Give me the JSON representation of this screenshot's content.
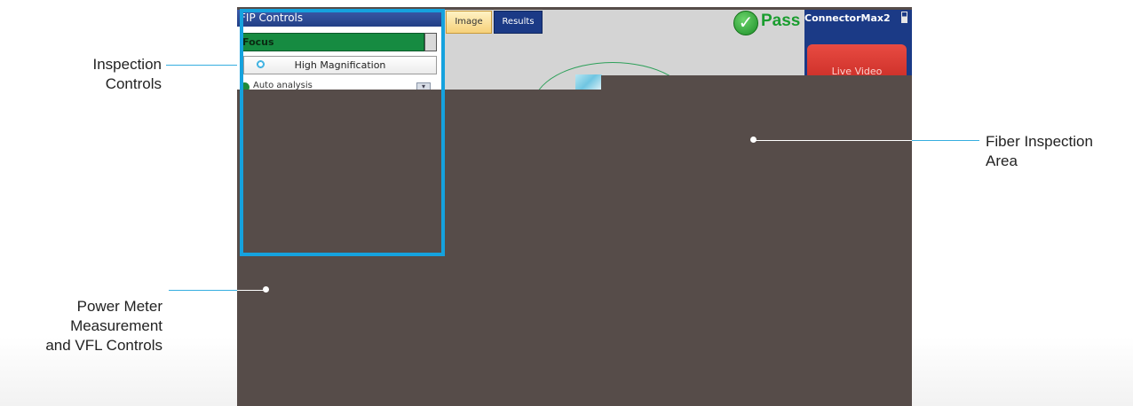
{
  "callouts": {
    "inspection_line1": "Inspection",
    "inspection_line2": "Controls",
    "power_line1": "Power Meter",
    "power_line2": "Measurement",
    "power_line3": "and VFL Controls",
    "fiber_line1": "Fiber Inspection",
    "fiber_line2": "Area"
  },
  "fip_panel": {
    "title": "FIP Controls",
    "focus_label": "Focus",
    "high_magnification_label": "High Magnification",
    "auto_row_text": "Auto analysis"
  },
  "image_area": {
    "tabs": [
      {
        "label": "Image",
        "active": true
      },
      {
        "label": "Results",
        "active": false
      }
    ],
    "status": "Pass",
    "status_color": "#1a9d2f"
  },
  "sidebar": {
    "connector_name": "ConnectorMax2",
    "live_video_label": "Live Video"
  },
  "colors": {
    "highlight": "#15a2de",
    "screen_dark": "#564c49",
    "nav_blue": "#1b3a86",
    "focus_green": "#168b41"
  }
}
